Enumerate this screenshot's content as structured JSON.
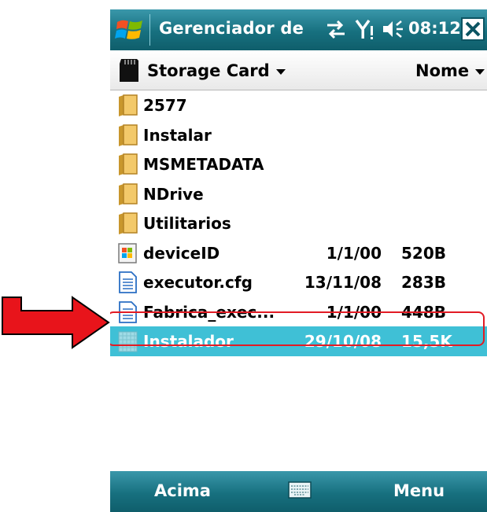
{
  "window": {
    "title": "Gerenciador de",
    "clock": "08:12"
  },
  "header": {
    "location": "Storage Card",
    "sort_by": "Nome"
  },
  "files": [
    {
      "name": "2577",
      "date": "",
      "size": "",
      "icon": "folder-icon"
    },
    {
      "name": "Instalar",
      "date": "",
      "size": "",
      "icon": "folder-icon"
    },
    {
      "name": "MSMETADATA",
      "date": "",
      "size": "",
      "icon": "folder-icon"
    },
    {
      "name": "NDrive",
      "date": "",
      "size": "",
      "icon": "folder-icon"
    },
    {
      "name": "Utilitarios",
      "date": "",
      "size": "",
      "icon": "folder-icon"
    },
    {
      "name": "deviceID",
      "date": "1/1/00",
      "size": "520B",
      "icon": "app-icon"
    },
    {
      "name": "executor.cfg",
      "date": "13/11/08",
      "size": "283B",
      "icon": "document-icon"
    },
    {
      "name": "Fabrica_exec...",
      "date": "1/1/00",
      "size": "448B",
      "icon": "document-icon"
    },
    {
      "name": "Instalador",
      "date": "29/10/08",
      "size": "15,5K",
      "icon": "installer-icon",
      "selected": true
    }
  ],
  "softkeys": {
    "left": "Acima",
    "right": "Menu"
  },
  "colors": {
    "titlebar": "#17707f",
    "selection": "#3fc0d6",
    "annotation": "#e21b24"
  }
}
